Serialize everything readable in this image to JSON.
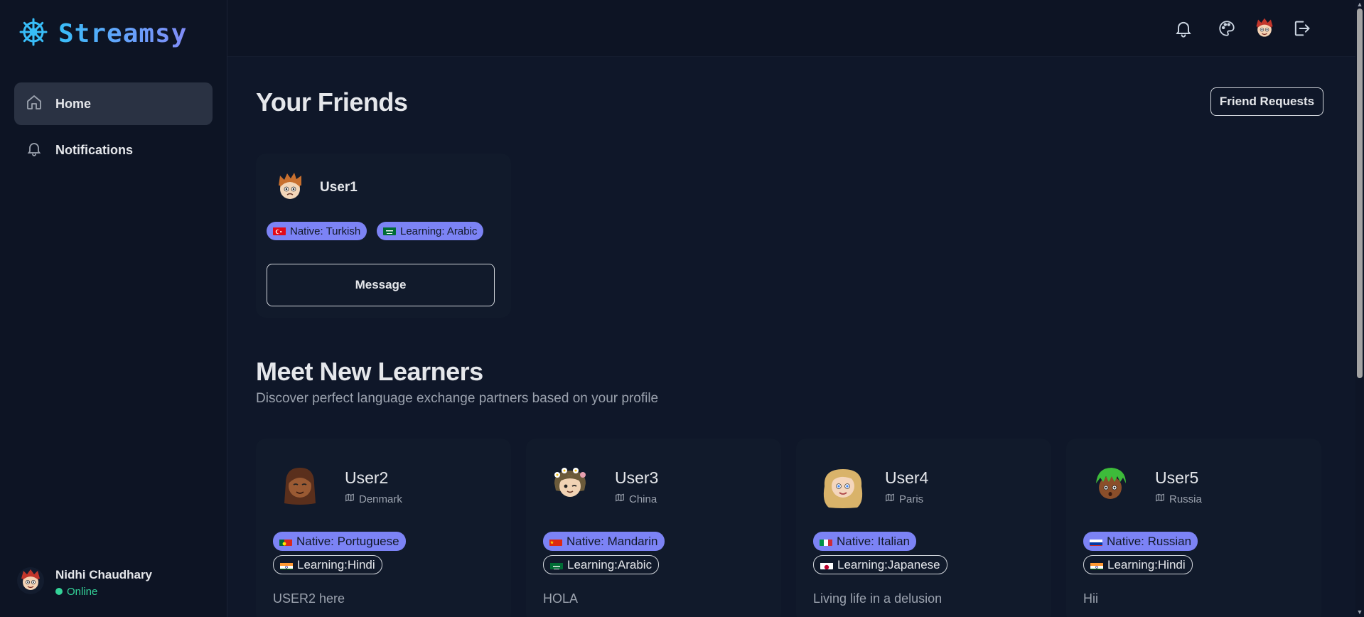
{
  "app": {
    "name": "Streamsy"
  },
  "sidebar": {
    "items": [
      {
        "label": "Home",
        "icon": "home-icon",
        "active": true
      },
      {
        "label": "Notifications",
        "icon": "bell-icon",
        "active": false
      }
    ],
    "user": {
      "name": "Nidhi Chaudhary",
      "status": "Online"
    }
  },
  "topbar": {
    "icons": [
      "bell-icon",
      "palette-icon",
      "avatar",
      "logout-icon"
    ]
  },
  "friends": {
    "title": "Your Friends",
    "requests_label": "Friend Requests",
    "items": [
      {
        "name": "User1",
        "native": "Native: Turkish",
        "learning": "Learning: Arabic",
        "message_label": "Message"
      }
    ]
  },
  "learners": {
    "title": "Meet New Learners",
    "subtitle": "Discover perfect language exchange partners based on your profile",
    "items": [
      {
        "name": "User2",
        "location": "Denmark",
        "native": "Native: Portuguese",
        "learning": "Learning:Hindi",
        "bio": "USER2 here"
      },
      {
        "name": "User3",
        "location": "China",
        "native": "Native: Mandarin",
        "learning": "Learning:Arabic",
        "bio": "HOLA"
      },
      {
        "name": "User4",
        "location": "Paris",
        "native": "Native: Italian",
        "learning": "Learning:Japanese",
        "bio": "Living life in a delusion"
      },
      {
        "name": "User5",
        "location": "Russia",
        "native": "Native: Russian",
        "learning": "Learning:Hindi",
        "bio": "Hii"
      }
    ]
  },
  "colors": {
    "background": "#0f1729",
    "sidebar": "#0d1424",
    "card": "#111a2b",
    "badge": "#7c83f5",
    "online": "#34d399",
    "brand_gradient": [
      "#38bdf8",
      "#818cf8"
    ]
  }
}
